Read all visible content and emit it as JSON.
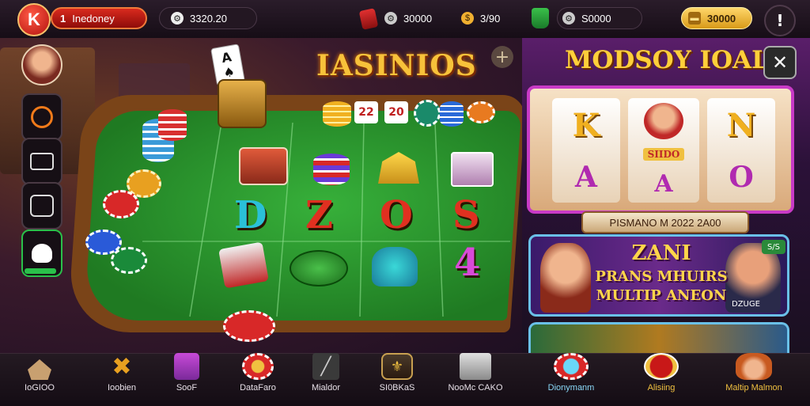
{
  "top_bar": {
    "logo_letter": "K",
    "user_level": "1",
    "user_name": "Inedoney",
    "balance_main": "3320.20",
    "coin_a": "30000",
    "coin_b": "3/90",
    "coin_c": "S0000",
    "gold_balance": "30000",
    "menu_glyph": "!"
  },
  "game": {
    "title": "IASINIOS",
    "plus_glyph": "+",
    "card_rank": "A",
    "card_suit": "♠",
    "table_symbols": [
      "D",
      "Z",
      "O",
      "S",
      "4"
    ],
    "dice_labels": [
      "22",
      "20"
    ]
  },
  "promo": {
    "title": "MODSOY IOALO",
    "close_glyph": "✕",
    "reel_top": [
      "K",
      "N"
    ],
    "reel_bottom": [
      "A",
      "A",
      "O"
    ],
    "center_label": "SIIDO",
    "jackpot_text": "PISMANO M 2022 2A00",
    "banner1_line1": "ZANI",
    "banner1_line2": "PRANS MHUIRS",
    "banner1_line3": "MULTIP ANEON",
    "banner1_tag": "DZUGE",
    "banner1_badge": "S/S"
  },
  "bottom_nav": [
    {
      "label": "IoGIOO"
    },
    {
      "label": "Ioobien"
    },
    {
      "label": "SooF"
    },
    {
      "label": "DataFaro"
    },
    {
      "label": "Mialdor"
    },
    {
      "label": "SI0BKaS"
    },
    {
      "label": "NooMc CAKO"
    },
    {
      "label": "Dionymanm"
    },
    {
      "label": "Alisiing"
    },
    {
      "label": "Maltip Malmon"
    }
  ],
  "colors": {
    "felt": "#2a9a2e",
    "gold": "#f7c23a",
    "red_accent": "#d92a1e",
    "purple_panel": "#5a1e6a",
    "banner_border": "#6ac0e8"
  }
}
